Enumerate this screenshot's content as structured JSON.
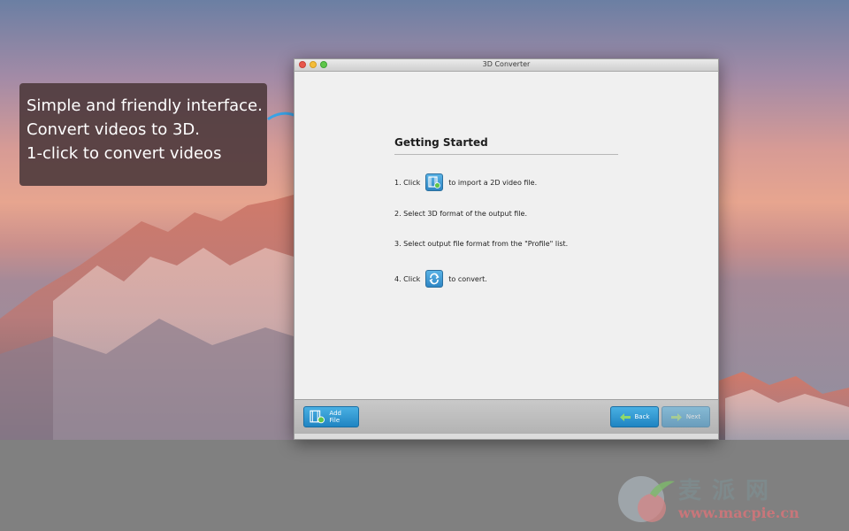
{
  "promo": {
    "lines": [
      "Simple and friendly interface.",
      "Convert videos to 3D.",
      "1-click to convert videos"
    ]
  },
  "window": {
    "title": "3D Converter"
  },
  "getting_started": {
    "title": "Getting Started",
    "step1_prefix": "1. Click",
    "step1_suffix": "to import a 2D video file.",
    "step2": "2. Select 3D format of the output file.",
    "step3": "3. Select output file format from the \"Profile\" list.",
    "step4_prefix": "4. Click",
    "step4_suffix": "to convert."
  },
  "toolbar": {
    "add_file_label": "Add File",
    "back_label": "Back",
    "next_label": "Next"
  },
  "icons": {
    "add_file": "film-add-icon",
    "convert": "convert-arrows-icon",
    "back": "arrow-left-icon",
    "next": "arrow-right-icon",
    "callout_arrow": "curved-arrow-icon"
  },
  "watermark": {
    "text": "麦派网",
    "url": "www.macpie.cn"
  },
  "colors": {
    "button_blue": "#2a8fd0",
    "callout_bg": "#4e3a3c",
    "bottom_band": "#808080"
  }
}
